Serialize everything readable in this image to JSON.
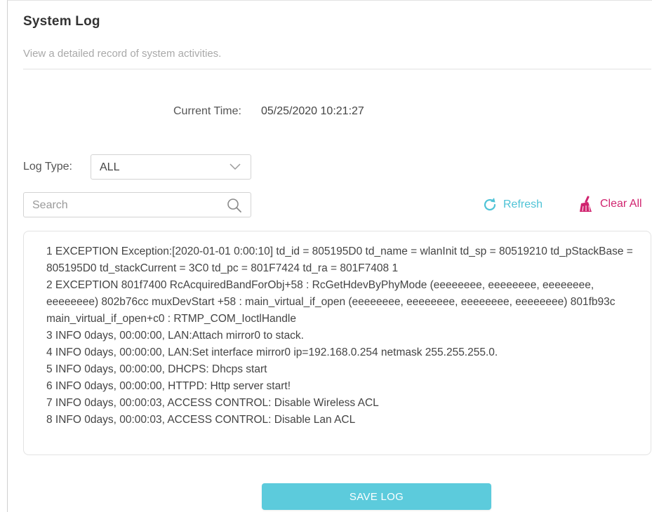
{
  "header": {
    "title": "System Log",
    "subtitle": "View a detailed record of system activities."
  },
  "current_time": {
    "label": "Current Time:",
    "value": "05/25/2020 10:21:27"
  },
  "log_type": {
    "label": "Log Type:",
    "selected": "ALL"
  },
  "search": {
    "placeholder": "Search",
    "value": ""
  },
  "actions": {
    "refresh_label": "Refresh",
    "clear_label": "Clear All"
  },
  "log": {
    "lines": [
      "1 EXCEPTION Exception:[2020-01-01 0:00:10] td_id = 805195D0 td_name = wlanInit td_sp = 80519210 td_pStackBase = 805195D0 td_stackCurrent = 3C0 td_pc = 801F7424 td_ra = 801F7408 1",
      "2 EXCEPTION 801f7400 RcAcquiredBandForObj+58 : RcGetHdevByPhyMode (eeeeeeee, eeeeeeee, eeeeeeee, eeeeeeee) 802b76cc muxDevStart +58 : main_virtual_if_open (eeeeeeee, eeeeeeee, eeeeeeee, eeeeeeee) 801fb93c main_virtual_if_open+c0 : RTMP_COM_IoctlHandle",
      "3 INFO 0days, 00:00:00, LAN:Attach mirror0 to stack.",
      "4 INFO 0days, 00:00:00, LAN:Set interface mirror0 ip=192.168.0.254 netmask 255.255.255.0.",
      "5 INFO 0days, 00:00:00, DHCPS: Dhcps start",
      "6 INFO 0days, 00:00:00, HTTPD: Http server start!",
      "7 INFO 0days, 00:00:03, ACCESS CONTROL: Disable Wireless ACL",
      "8 INFO 0days, 00:00:03, ACCESS CONTROL: Disable Lan ACL"
    ]
  },
  "footer": {
    "save_label": "SAVE LOG"
  },
  "colors": {
    "accent": "#5ccbdc",
    "refresh": "#4fc3d6",
    "clear": "#d0246f"
  },
  "icons": {
    "select": "chevron-down-icon",
    "search": "search-icon",
    "refresh": "refresh-icon",
    "clear": "broom-icon"
  }
}
